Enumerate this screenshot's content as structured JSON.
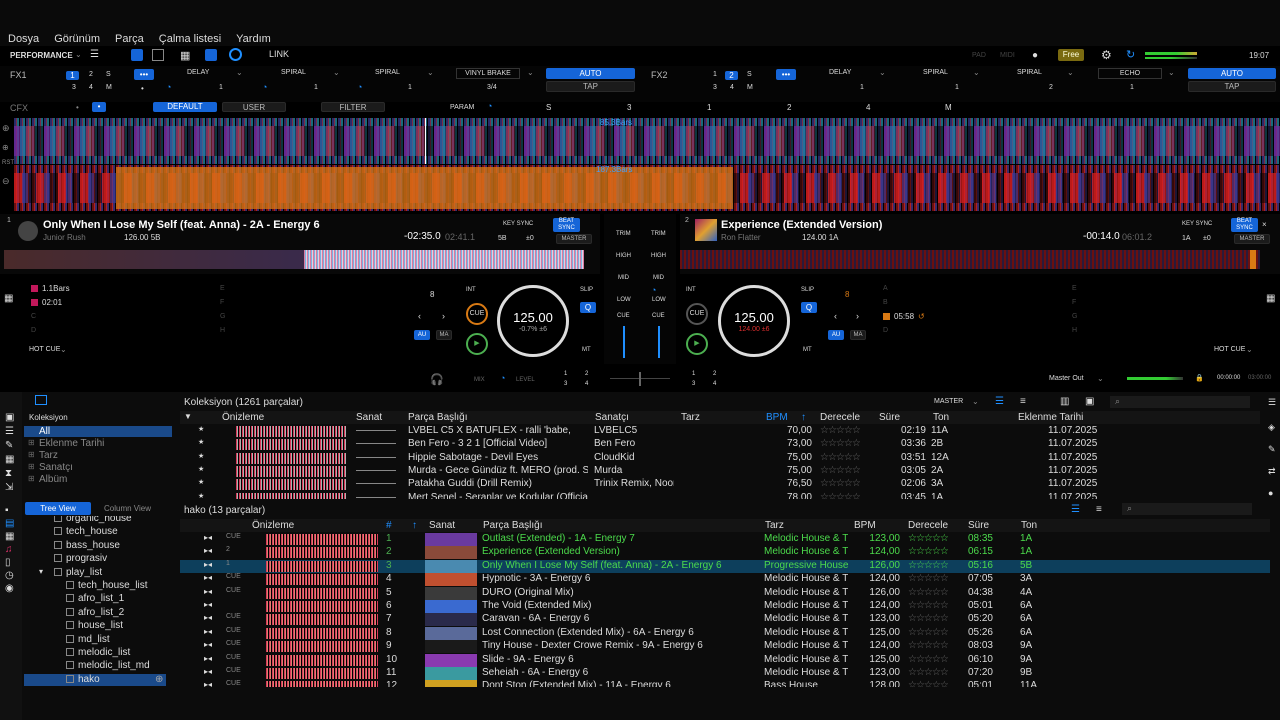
{
  "menu": {
    "items": [
      "Dosya",
      "Görünüm",
      "Parça",
      "Çalma listesi",
      "Yardım"
    ],
    "performance": "PERFORMANCE",
    "link": "LINK",
    "pad": "PAD",
    "midi": "MIDI",
    "free": "Free",
    "clock": "19:07"
  },
  "fx1": {
    "label": "FX1",
    "slots": [
      "DELAY",
      "SPIRAL",
      "SPIRAL"
    ],
    "preset": "VINYL BRAKE",
    "beat": "3/4",
    "auto": "AUTO",
    "tap": "TAP",
    "nums": [
      "1",
      "2",
      "S",
      "3",
      "4",
      "M"
    ],
    "vals": [
      "1",
      "1",
      "1"
    ]
  },
  "fx2": {
    "label": "FX2",
    "slots": [
      "DELAY",
      "SPIRAL",
      "SPIRAL"
    ],
    "preset": "ECHO",
    "beat": "1",
    "auto": "AUTO",
    "tap": "TAP",
    "nums": [
      "1",
      "2",
      "S",
      "3",
      "4",
      "M"
    ],
    "vals": [
      "1",
      "1",
      "2"
    ]
  },
  "cfx": {
    "label": "CFX",
    "default": "DEFAULT",
    "user": "USER",
    "filter": "FILTER",
    "param": "PARAM",
    "s": "S",
    "nums": [
      "3",
      "1",
      "2",
      "4",
      "M"
    ]
  },
  "wave": {
    "top_bars": "85.3Bars",
    "bottom_bars": "187.3Bars",
    "rst": "RST"
  },
  "deck1": {
    "num": "1",
    "title": "Only When I Lose My Self (feat. Anna) - 2A - Energy 6",
    "artist": "Junior Rush",
    "bpm_key": "126.00 5B",
    "time_remain": "-02:35.0",
    "time_total": "02:41.1",
    "key_sync": "KEY SYNC",
    "beat_sync": "BEAT SYNC",
    "master": "MASTER",
    "key_a": "5B",
    "key_b": "±0",
    "cue1": "1.1Bars",
    "cue2": "02:01",
    "cue_letters": [
      "C",
      "D",
      "E",
      "F",
      "G",
      "H"
    ],
    "loop": "8",
    "int": "INT",
    "slip": "SLIP",
    "q": "Q",
    "au": "AU",
    "ma": "MA",
    "mt": "MT",
    "cue": "CUE",
    "jog_bpm": "125.00",
    "jog_pitch": "-0.7% ±6",
    "hotcue": "HOT CUE"
  },
  "deck2": {
    "num": "2",
    "title": "Experience (Extended Version)",
    "artist": "Ron Flatter",
    "bpm_key": "124.00 1A",
    "time_remain": "-00:14.0",
    "time_total": "06:01.2",
    "key_sync": "KEY SYNC",
    "beat_sync": "BEAT SYNC",
    "master": "MASTER",
    "key_a": "1A",
    "key_b": "±0",
    "cue1": "05:58",
    "cue_letters": [
      "A",
      "B",
      "C",
      "D",
      "E",
      "F",
      "G",
      "H"
    ],
    "loop": "8",
    "int": "INT",
    "slip": "SLIP",
    "q": "Q",
    "au": "AU",
    "ma": "MA",
    "mt": "MT",
    "cue": "CUE",
    "jog_bpm": "125.00",
    "jog_pitch": "124.00 ±6",
    "hotcue": "HOT CUE"
  },
  "mixer": {
    "trim": "TRIM",
    "high": "HIGH",
    "mid": "MID",
    "low": "LOW",
    "cue": "CUE",
    "mix": "MIX",
    "level": "LEVEL",
    "master_out": "Master Out",
    "t1": "00:00:00",
    "t2": "03:00:00",
    "nums": [
      "1",
      "2",
      "3",
      "4",
      "1",
      "2",
      "3",
      "4"
    ]
  },
  "library": {
    "tree_title": "Koleksiyon",
    "tree": [
      "All",
      "Eklenme Tarihi",
      "Tarz",
      "Sanatçı",
      "Albüm"
    ],
    "coll_title": "Koleksiyon (1261 parçalar)",
    "master": "MASTER",
    "cols": [
      "Önizleme",
      "Sanat",
      "Parça Başlığı",
      "Sanatçı",
      "Tarz",
      "BPM",
      "Derecele",
      "Süre",
      "Ton",
      "Eklenme Tarihi"
    ],
    "rows": [
      {
        "title": "LVBEL C5 X BATUFLEX - ralli 'babe,",
        "artist": "LVBELC5",
        "bpm": "70,00",
        "time": "02:19",
        "key": "11A",
        "date": "11.07.2025"
      },
      {
        "title": "Ben Fero - 3 2 1 [Official Video]",
        "artist": "Ben Fero",
        "bpm": "73,00",
        "time": "03:36",
        "key": "2B",
        "date": "11.07.2025"
      },
      {
        "title": "Hippie Sabotage - Devil Eyes",
        "artist": "CloudKid",
        "bpm": "75,00",
        "time": "03:51",
        "key": "12A",
        "date": "11.07.2025"
      },
      {
        "title": "Murda - Gece Gündüz ft. MERO (prod. Sp",
        "artist": "Murda",
        "bpm": "75,00",
        "time": "03:05",
        "key": "2A",
        "date": "11.07.2025"
      },
      {
        "title": "Patakha Guddi (Drill Remix)",
        "artist": "Trinix Remix, Noor",
        "bpm": "76,50",
        "time": "02:06",
        "key": "3A",
        "date": "11.07.2025"
      },
      {
        "title": "Mert Şenel - Şeranlar ve Kodular (Official",
        "artist": "",
        "bpm": "78,00",
        "time": "03:45",
        "key": "1A",
        "date": "11.07.2025"
      }
    ]
  },
  "playlist": {
    "tab_tree": "Tree View",
    "tab_col": "Column View",
    "tree": [
      "organic_house",
      "tech_house",
      "bass_house",
      "prograsiv",
      "play_list",
      "tech_house_list",
      "afro_list_1",
      "afro_list_2",
      "house_list",
      "md_list",
      "melodic_list",
      "melodic_list_md",
      "hako"
    ],
    "title": "hako (13 parçalar)",
    "cols": [
      "Önizleme",
      "#",
      "Sanat",
      "Parça Başlığı",
      "Tarz",
      "BPM",
      "Derecele",
      "Süre",
      "Ton"
    ],
    "rows": [
      {
        "n": "1",
        "title": "Outlast (Extended) - 1A - Energy 7",
        "genre": "Melodic House & T",
        "bpm": "123,00",
        "time": "08:35",
        "key": "1A",
        "cue": "CUE",
        "color": "#4caf50"
      },
      {
        "n": "2",
        "title": "Experience (Extended Version)",
        "genre": "Melodic House & T",
        "bpm": "124,00",
        "time": "06:15",
        "key": "1A",
        "cue": "2",
        "color": "#4caf50"
      },
      {
        "n": "3",
        "title": "Only When I Lose My Self (feat. Anna) - 2A - Energy 6",
        "genre": "Progressive House",
        "bpm": "126,00",
        "time": "05:16",
        "key": "5B",
        "cue": "1",
        "color": "#4caf50"
      },
      {
        "n": "4",
        "title": "Hypnotic - 3A - Energy 6",
        "genre": "Melodic House & T",
        "bpm": "124,00",
        "time": "07:05",
        "key": "3A",
        "cue": "CUE",
        "color": "#ddd"
      },
      {
        "n": "5",
        "title": "DURO (Original Mix)",
        "genre": "Melodic House & T",
        "bpm": "126,00",
        "time": "04:38",
        "key": "4A",
        "cue": "CUE",
        "color": "#ddd"
      },
      {
        "n": "6",
        "title": "The Void (Extended Mix)",
        "genre": "Melodic House & T",
        "bpm": "124,00",
        "time": "05:01",
        "key": "6A",
        "cue": "",
        "color": "#ddd"
      },
      {
        "n": "7",
        "title": "Caravan - 6A - Energy 6",
        "genre": "Melodic House & T",
        "bpm": "123,00",
        "time": "05:20",
        "key": "6A",
        "cue": "CUE",
        "color": "#ddd"
      },
      {
        "n": "8",
        "title": "Lost Connection (Extended Mix) - 6A - Energy 6",
        "genre": "Melodic House & T",
        "bpm": "125,00",
        "time": "05:26",
        "key": "6A",
        "cue": "CUE",
        "color": "#ddd"
      },
      {
        "n": "9",
        "title": "Tiny House - Dexter Crowe Remix - 9A - Energy 6",
        "genre": "Melodic House & T",
        "bpm": "124,00",
        "time": "08:03",
        "key": "9A",
        "cue": "CUE",
        "color": "#ddd"
      },
      {
        "n": "10",
        "title": "Slide - 9A - Energy 6",
        "genre": "Melodic House & T",
        "bpm": "125,00",
        "time": "06:10",
        "key": "9A",
        "cue": "CUE",
        "color": "#ddd"
      },
      {
        "n": "11",
        "title": "Seheiah - 6A - Energy 6",
        "genre": "Melodic House & T",
        "bpm": "123,00",
        "time": "07:20",
        "key": "9B",
        "cue": "CUE",
        "color": "#ddd"
      },
      {
        "n": "12",
        "title": "Dont Stop (Extended Mix) - 11A - Energy 6",
        "genre": "Bass House",
        "bpm": "128,00",
        "time": "05:01",
        "key": "11A",
        "cue": "CUE",
        "color": "#ddd"
      }
    ]
  },
  "colors": {
    "accent": "#1f8fff",
    "selected_row": "#0d3f5c",
    "green_text": "#4cdb4c",
    "orange_wave": "#d97a14"
  }
}
